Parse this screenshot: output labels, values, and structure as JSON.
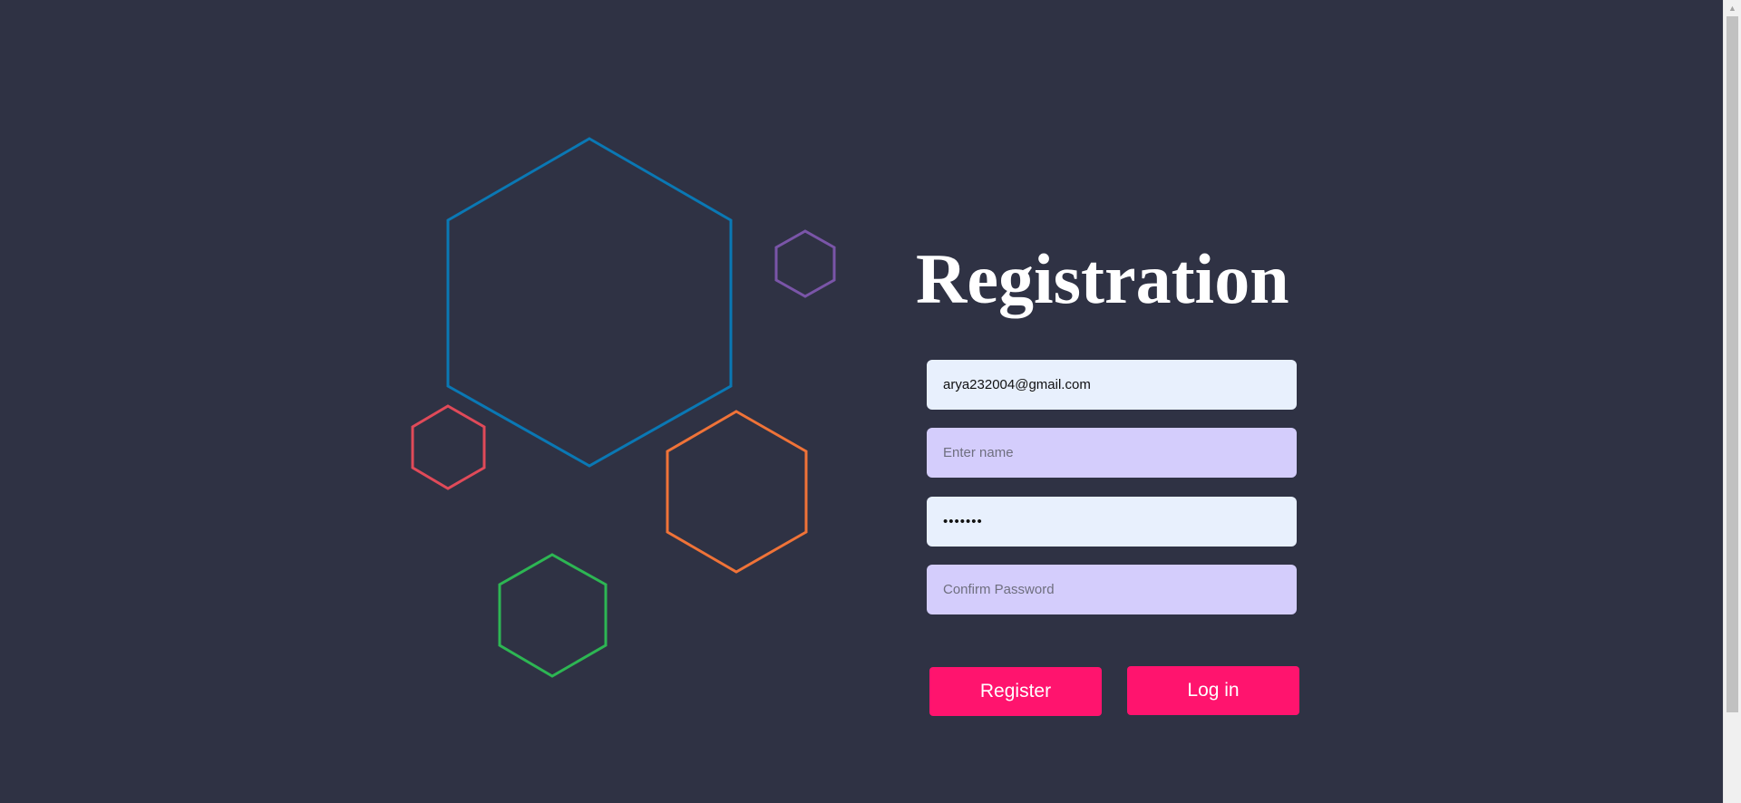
{
  "form": {
    "title": "Registration",
    "email_value": "arya232004@gmail.com",
    "name_placeholder": "Enter name",
    "password_value": "1234567",
    "confirm_placeholder": "Confirm Password"
  },
  "buttons": {
    "register_label": "Register",
    "login_label": "Log in"
  },
  "decorations": [
    {
      "name": "large-blue-hexagon",
      "color": "#0a78b4"
    },
    {
      "name": "small-purple-hexagon",
      "color": "#7a55a8"
    },
    {
      "name": "small-red-hexagon",
      "color": "#e04a59"
    },
    {
      "name": "orange-hexagon",
      "color": "#f07338"
    },
    {
      "name": "green-hexagon",
      "color": "#2db653"
    }
  ],
  "colors": {
    "background": "#2f3244",
    "accent": "#ff146e",
    "field_light": "#e8f0fd",
    "field_violet": "#d4cdfc"
  },
  "scrollbar": {
    "up_arrow_icon": "triangle-up-icon"
  }
}
